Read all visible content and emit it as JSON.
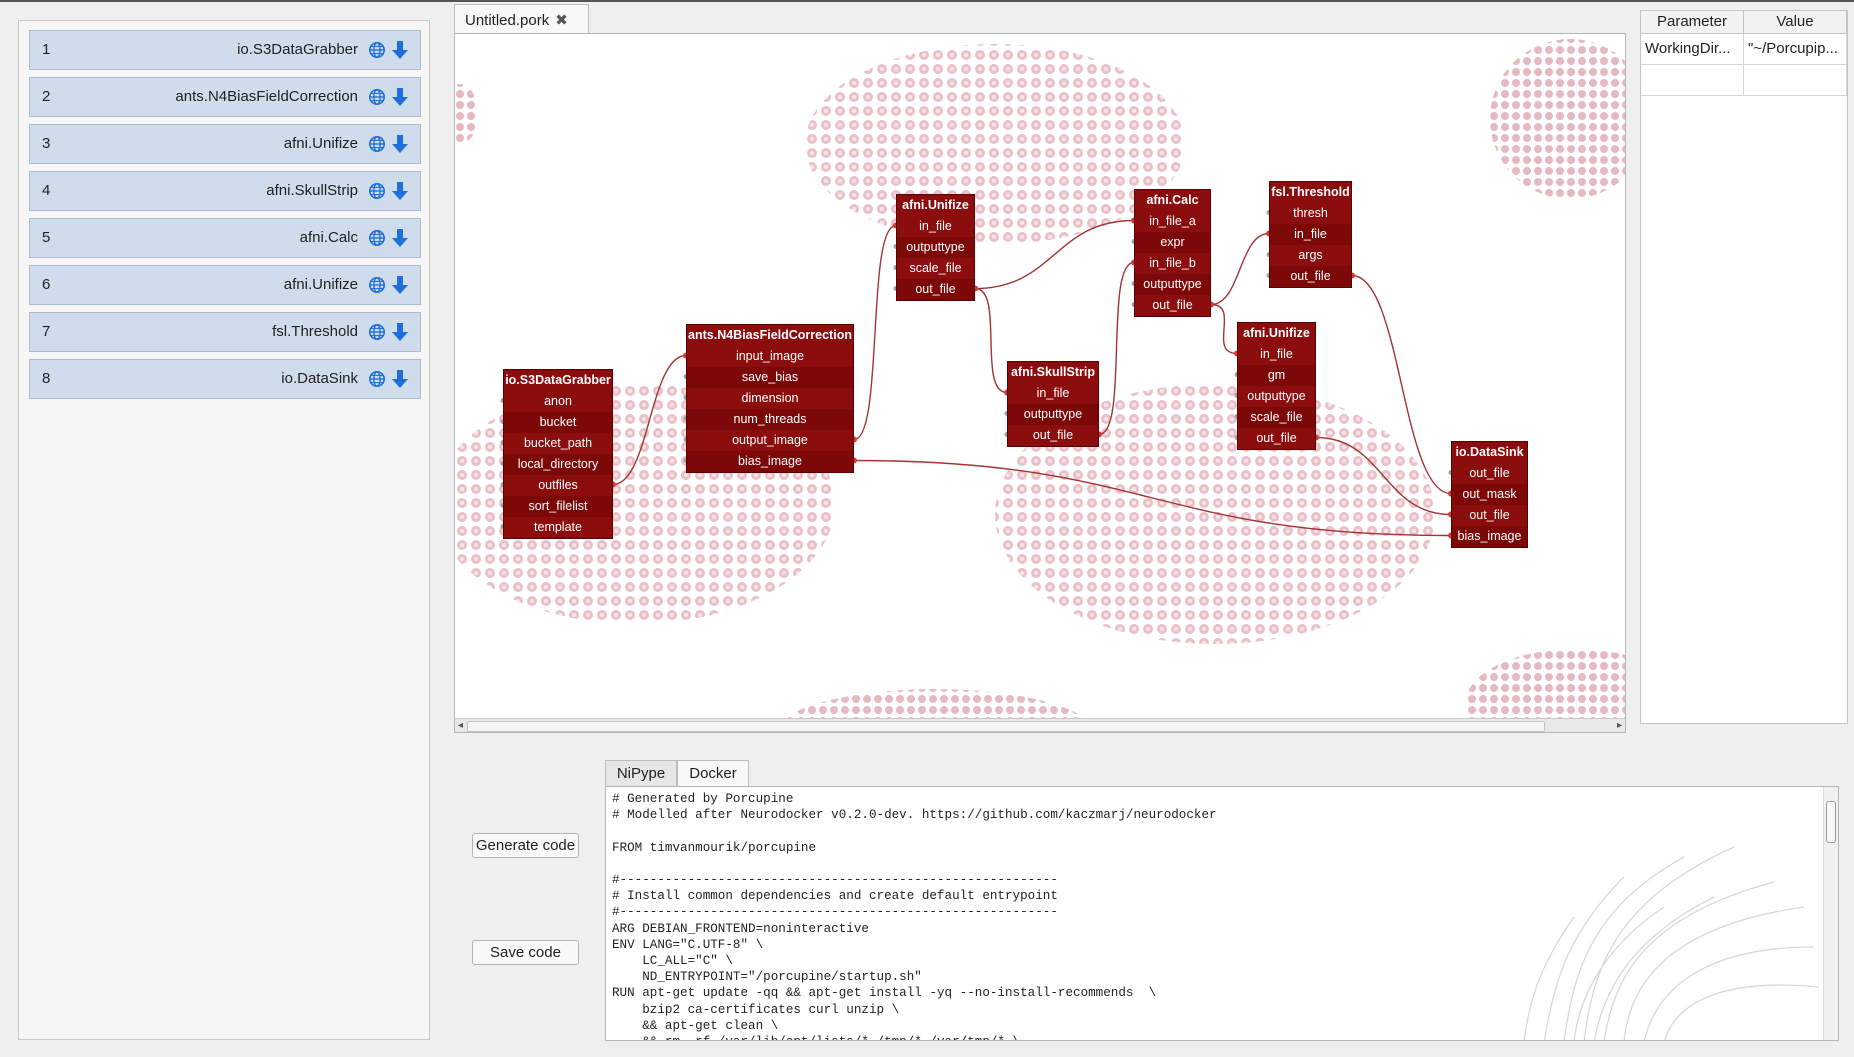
{
  "node_list": [
    {
      "num": "1",
      "name": "io.S3DataGrabber"
    },
    {
      "num": "2",
      "name": "ants.N4BiasFieldCorrection"
    },
    {
      "num": "3",
      "name": "afni.Unifize"
    },
    {
      "num": "4",
      "name": "afni.SkullStrip"
    },
    {
      "num": "5",
      "name": "afni.Calc"
    },
    {
      "num": "6",
      "name": "afni.Unifize"
    },
    {
      "num": "7",
      "name": "fsl.Threshold"
    },
    {
      "num": "8",
      "name": "io.DataSink"
    }
  ],
  "editor": {
    "tab_label": "Untitled.pork",
    "tab_close": "✖"
  },
  "graph_nodes": [
    {
      "id": "s3",
      "title": "io.S3DataGrabber",
      "ports": [
        "anon",
        "bucket",
        "bucket_path",
        "local_directory",
        "outfiles",
        "sort_filelist",
        "template"
      ]
    },
    {
      "id": "n4",
      "title": "ants.N4BiasFieldCorrection",
      "ports": [
        "input_image",
        "save_bias",
        "dimension",
        "num_threads",
        "output_image",
        "bias_image"
      ]
    },
    {
      "id": "uni1",
      "title": "afni.Unifize",
      "ports": [
        "in_file",
        "outputtype",
        "scale_file",
        "out_file"
      ]
    },
    {
      "id": "skull",
      "title": "afni.SkullStrip",
      "ports": [
        "in_file",
        "outputtype",
        "out_file"
      ]
    },
    {
      "id": "calc",
      "title": "afni.Calc",
      "ports": [
        "in_file_a",
        "expr",
        "in_file_b",
        "outputtype",
        "out_file"
      ]
    },
    {
      "id": "thresh",
      "title": "fsl.Threshold",
      "ports": [
        "thresh",
        "in_file",
        "args",
        "out_file"
      ]
    },
    {
      "id": "uni2",
      "title": "afni.Unifize",
      "ports": [
        "in_file",
        "gm",
        "outputtype",
        "scale_file",
        "out_file"
      ]
    },
    {
      "id": "sink",
      "title": "io.DataSink",
      "ports": [
        "out_file",
        "out_mask",
        "out_file",
        "bias_image"
      ]
    }
  ],
  "params": {
    "headers": [
      "Parameter",
      "Value"
    ],
    "rows": [
      [
        "WorkingDir...",
        "\"~/Porcupip..."
      ]
    ]
  },
  "buttons": {
    "generate": "Generate code",
    "save": "Save code"
  },
  "code_tabs": [
    "NiPype",
    "Docker"
  ],
  "code_text": "# Generated by Porcupine\n# Modelled after Neurodocker v0.2.0-dev. https://github.com/kaczmarj/neurodocker\n\nFROM timvanmourik/porcupine\n\n#----------------------------------------------------------\n# Install common dependencies and create default entrypoint\n#----------------------------------------------------------\nARG DEBIAN_FRONTEND=noninteractive\nENV LANG=\"C.UTF-8\" \\\n    LC_ALL=\"C\" \\\n    ND_ENTRYPOINT=\"/porcupine/startup.sh\"\nRUN apt-get update -qq && apt-get install -yq --no-install-recommends  \\\n    bzip2 ca-certificates curl unzip \\\n    && apt-get clean \\\n    && rm -rf /var/lib/apt/lists/* /tmp/* /var/tmp/* \\",
  "colors": {
    "node": "#8b0d0d",
    "link": "#a33333",
    "list_bg": "#cfdcec",
    "icon_blue": "#1e6fd9"
  }
}
